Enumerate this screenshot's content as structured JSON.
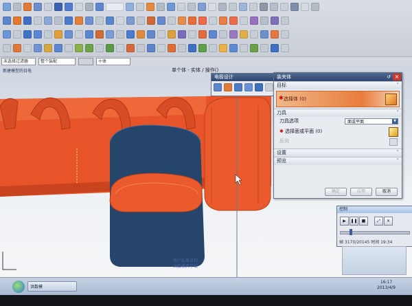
{
  "viewport": {
    "left_title": "新建模型的日电",
    "center_title": "单个体 - 实体 / 操作()",
    "watermark_line1": "周户乱单日构",
    "watermark_line2": "洪数模具学校"
  },
  "selection_bar": {
    "box1": "未选择过滤器",
    "box2": "整个装配",
    "box3": "十体"
  },
  "electrode_dialog": {
    "title": "电极设计"
  },
  "dialog": {
    "title": "装夹体",
    "section_target": "目标",
    "select_body_label": "选择体 (0)",
    "section_tool": "刀具",
    "tool_option_label": "刀具选项",
    "tool_option_value": "面或平面",
    "select_face_label": "选择面或平面 (0)",
    "reverse_direction": "反向",
    "section_settings": "设置",
    "section_preview": "预览",
    "ok": "确定",
    "apply": "应用",
    "cancel": "取消"
  },
  "control_panel": {
    "title": "控制",
    "frame_text": "帧 3170/20145 时间 19:34"
  },
  "taskbar": {
    "task_label": "洪数模",
    "time": "16:17",
    "date": "2013/4/9"
  },
  "colors": {
    "model_orange": "#e8542a",
    "model_blue": "#25456a",
    "dialog_title": "#2e4670"
  }
}
